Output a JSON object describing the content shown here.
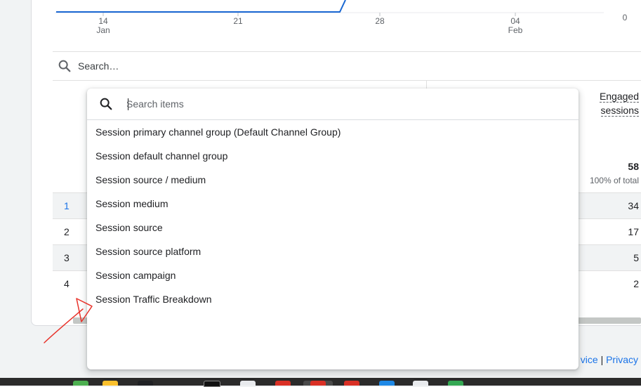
{
  "chart_axis": {
    "ticks": [
      {
        "day": "14",
        "month": "Jan"
      },
      {
        "day": "21",
        "month": ""
      },
      {
        "day": "28",
        "month": ""
      },
      {
        "day": "04",
        "month": "Feb"
      }
    ],
    "right_axis_value": "0",
    "line_color": "#1967d2"
  },
  "table_search": {
    "placeholder": "Search…"
  },
  "table": {
    "metric_header": [
      "Engaged",
      "sessions"
    ],
    "total": "58",
    "total_pct": "100% of total",
    "rows": [
      {
        "index": "1",
        "value": "34"
      },
      {
        "index": "2",
        "value": "17"
      },
      {
        "index": "3",
        "value": "5"
      },
      {
        "index": "4",
        "value": "2"
      }
    ]
  },
  "dropdown": {
    "search_placeholder": "Search items",
    "items": [
      "Session primary channel group (Default Channel Group)",
      "Session default channel group",
      "Session source / medium",
      "Session medium",
      "Session source",
      "Session source platform",
      "Session campaign",
      "Session Traffic Breakdown"
    ]
  },
  "footer": {
    "link1": "vice",
    "separator": "|",
    "link2": "Privacy"
  },
  "annotation_color": "#e8322a",
  "icons": {
    "search": "search-icon"
  }
}
